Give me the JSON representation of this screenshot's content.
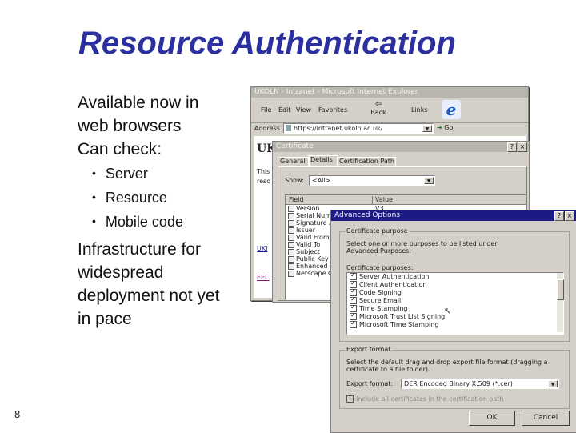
{
  "slide": {
    "title": "Resource Authentication",
    "intro_line1": "Available now in",
    "intro_line2": "web browsers",
    "can_check": "Can check:",
    "sub_items": [
      "Server",
      "Resource",
      "Mobile code"
    ],
    "infra": [
      "Infrastructure for",
      "widespread",
      "deployment not yet",
      "in pace"
    ],
    "number": "8"
  },
  "browser": {
    "title": "UKOLN - Intranet - Microsoft Internet Explorer",
    "menu": [
      "File",
      "Edit",
      "View",
      "Favorites"
    ],
    "back_label": "Back",
    "links_label": "Links",
    "address_label": "Address",
    "url": "https://intranet.ukoln.ac.uk/",
    "go_label": "Go",
    "page_heading": "UK",
    "page_text": [
      "This",
      "reso"
    ],
    "page_links": [
      "UKI",
      "EEC"
    ]
  },
  "certificate": {
    "title": "Certificate",
    "tabs": [
      "General",
      "Details",
      "Certification Path"
    ],
    "show_label": "Show:",
    "show_value": "<All>",
    "columns": [
      "Field",
      "Value"
    ],
    "fields": [
      "Version",
      "Serial Number",
      "Signature Al",
      "Issuer",
      "Valid From",
      "Valid To",
      "Subject",
      "Public Key",
      "Enhanced K",
      "Netscape C"
    ],
    "first_value": "V3"
  },
  "advanced": {
    "title": "Advanced Options",
    "group_purpose": "Certificate purpose",
    "purpose_desc": "Select one or more purposes to be listed under Advanced Purposes.",
    "purposes_label": "Certificate purposes:",
    "purposes": [
      {
        "label": "Server Authentication",
        "checked": true
      },
      {
        "label": "Client Authentication",
        "checked": true
      },
      {
        "label": "Code Signing",
        "checked": true
      },
      {
        "label": "Secure Email",
        "checked": true
      },
      {
        "label": "Time Stamping",
        "checked": true
      },
      {
        "label": "Microsoft Trust List Signing",
        "checked": true
      },
      {
        "label": "Microsoft Time Stamping",
        "checked": true
      }
    ],
    "group_export": "Export format",
    "export_desc": "Select the default drag and drop export file format (dragging a certificate to a file folder).",
    "export_label": "Export format:",
    "export_value": "DER Encoded Binary X.509 (*.cer)",
    "include_label": "Include all certificates in the certification path",
    "ok_label": "OK",
    "cancel_label": "Cancel"
  }
}
